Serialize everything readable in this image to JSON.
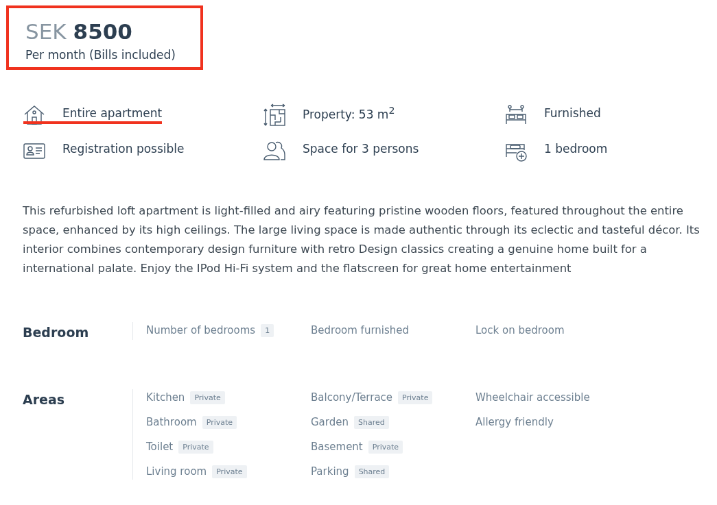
{
  "price": {
    "currency": "SEK",
    "amount": "8500",
    "period": "Per month (Bills included)",
    "highlighted": true
  },
  "features": [
    {
      "text": "Entire apartment",
      "highlighted": true
    },
    {
      "text": "Property: 53 m$^{2}$",
      "highlighted": false
    },
    {
      "text": "Furnished",
      "highlighted": false
    },
    {
      "text": "Registration possible",
      "highlighted": false
    },
    {
      "text": "Space for 3 persons",
      "highlighted": false
    },
    {
      "text": "1 bedroom",
      "highlighted": false
    }
  ],
  "description": "This refurbished loft apartment is light-filled and airy featuring pristine wooden floors, featured throughout the entire space, enhanced by its high ceilings. The large living space is made authentic through its eclectic and tasteful décor. Its interior combines contemporary design furniture with retro Design classics creating a genuine home built for a international palate. Enjoy the IPod Hi-Fi system and the flatscreen for great home entertainment",
  "sections": [
    {
      "title": "Bedroom",
      "columns": [
        [
          {
            "label": "Number of bedrooms",
            "tag": "1"
          }
        ],
        [
          {
            "label": "Bedroom furnished"
          }
        ],
        [
          {
            "label": "Lock on bedroom"
          }
        ]
      ]
    },
    {
      "title": "Areas",
      "columns": [
        [
          {
            "label": "Kitchen",
            "tag": "Private"
          },
          {
            "label": "Bathroom",
            "tag": "Private"
          },
          {
            "label": "Toilet",
            "tag": "Private"
          },
          {
            "label": "Living room",
            "tag": "Private"
          }
        ],
        [
          {
            "label": "Balcony/Terrace",
            "tag": "Private"
          },
          {
            "label": "Garden",
            "tag": "Shared"
          },
          {
            "label": "Basement",
            "tag": "Private"
          },
          {
            "label": "Parking",
            "tag": "Shared"
          }
        ],
        [
          {
            "label": "Wheelchair accessible"
          },
          {
            "label": "Allergy friendly"
          }
        ]
      ]
    }
  ]
}
